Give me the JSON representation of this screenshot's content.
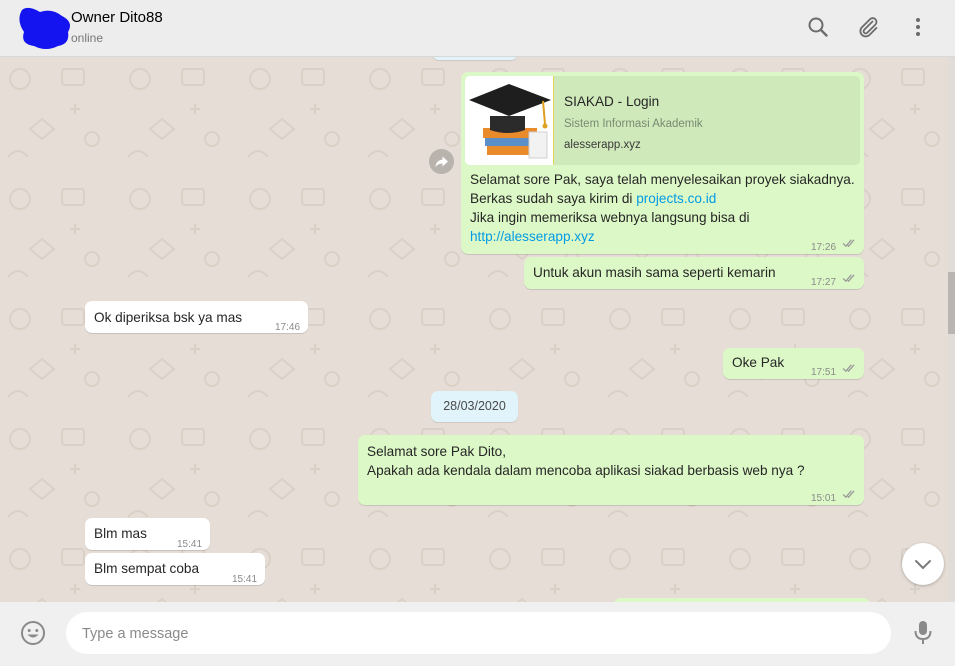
{
  "header": {
    "contact_name": "Owner Dito88",
    "status": "online",
    "icons": [
      "search-icon",
      "attach-icon",
      "menu-icon"
    ]
  },
  "messages": {
    "m1": {
      "preview_title": "SIAKAD - Login",
      "preview_desc": "Sistem Informasi Akademik",
      "preview_domain": "alesserapp.xyz",
      "line1": "Selamat sore Pak, saya telah menyelesaikan proyek siakadnya.",
      "line2_text": "Berkas sudah saya kirim di ",
      "line2_link": "projects.co.id",
      "line3": "Jika ingin memeriksa webnya langsung bisa di",
      "line4_link": "http://alesserapp.xyz",
      "time": "17:26"
    },
    "m2": {
      "text": "Untuk akun masih sama seperti kemarin",
      "time": "17:27"
    },
    "m3": {
      "text": "Ok diperiksa bsk ya mas",
      "time": "17:46"
    },
    "m4": {
      "text": "Oke Pak",
      "time": "17:51"
    },
    "date_separator": "28/03/2020",
    "m5": {
      "line1": "Selamat sore Pak Dito,",
      "line2": "Apakah ada kendala dalam mencoba aplikasi siakad berbasis web nya ?",
      "time": "15:01"
    },
    "m6": {
      "text": "Blm mas",
      "time": "15:41"
    },
    "m7": {
      "text": "Blm sempat coba",
      "time": "15:41"
    }
  },
  "composer": {
    "placeholder": "Type a message",
    "icons": [
      "emoji-icon",
      "microphone-icon"
    ]
  },
  "colors": {
    "outgoing_bubble": "#dcf8c6",
    "incoming_bubble": "#ffffff",
    "link": "#039be5",
    "date_chip": "#e1f3fb"
  }
}
